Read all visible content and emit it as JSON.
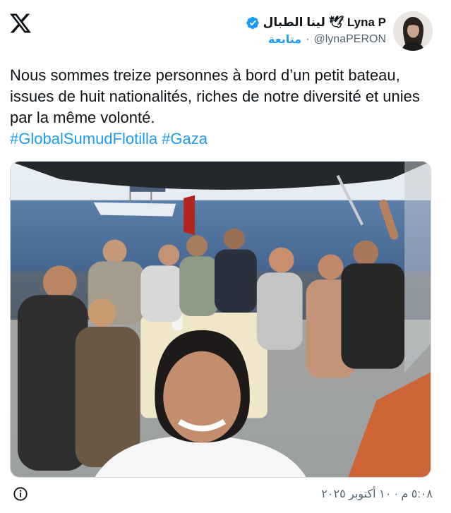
{
  "header": {
    "logo_icon": "x-logo-icon",
    "author": {
      "display_name": "لينا الطبال 🕊 Lyna P",
      "verified_icon": "verified-badge-icon",
      "handle": "@lynaPERON",
      "separator": "·",
      "follow_label": "متابعة",
      "avatar_icon": "profile-avatar"
    }
  },
  "tweet": {
    "text": "Nous sommes treize personnes à bord d’un petit bateau, issues de huit nationalités, riches de notre diversité et unies par la même volonté.",
    "hashtags": [
      "#GlobalSumudFlotilla",
      "#Gaza"
    ]
  },
  "footer": {
    "info_icon": "info-icon",
    "timestamp": "٥:٠٨ م · ١٠ أكتوبر ٢٠٢٥"
  },
  "colors": {
    "link": "#1d9bf0",
    "text": "#0f1419",
    "muted": "#536471"
  }
}
